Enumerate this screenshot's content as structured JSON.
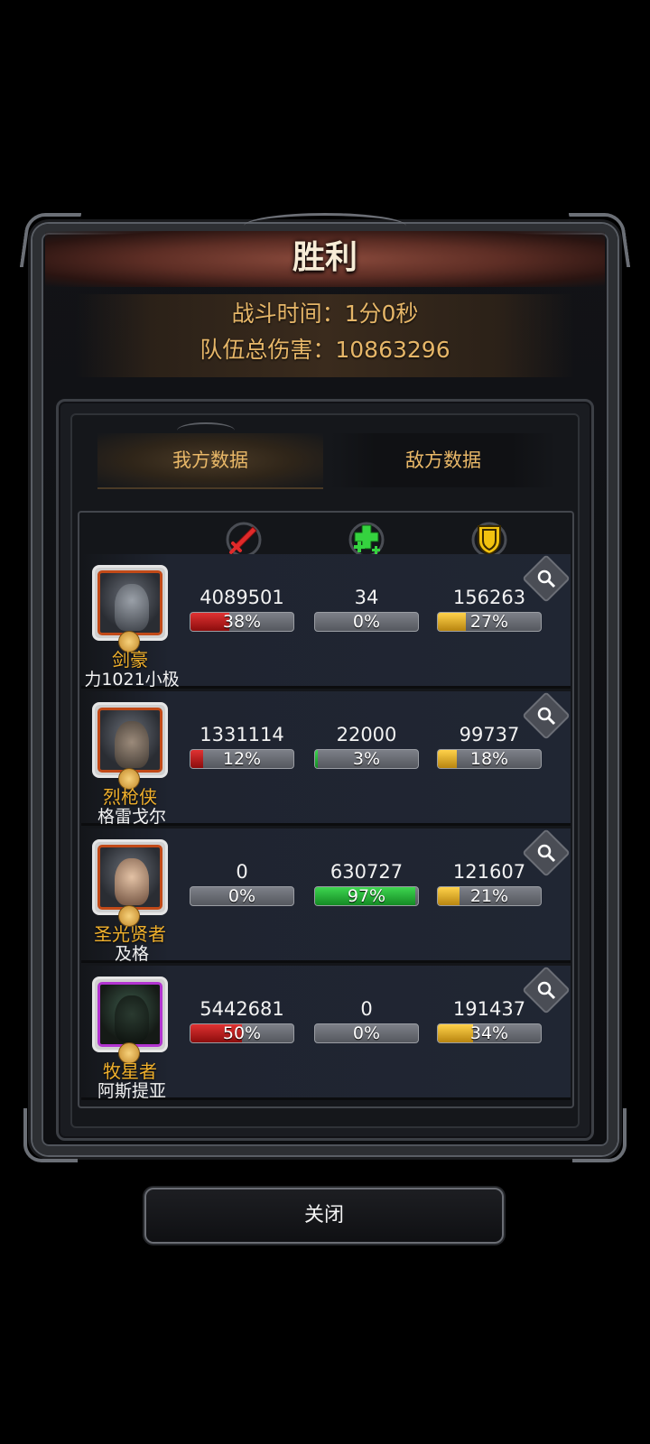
{
  "title": "胜利",
  "battle_time": {
    "label": "战斗时间：",
    "value": "1分0秒"
  },
  "team_damage": {
    "label": "队伍总伤害：",
    "value": "10863296"
  },
  "tabs": [
    {
      "label": "我方数据",
      "active": true
    },
    {
      "label": "敌方数据",
      "active": false
    }
  ],
  "columns": [
    {
      "icon": "sword-icon",
      "color": "#e02a2a"
    },
    {
      "icon": "heal-cross-icon",
      "color": "#35d33f"
    },
    {
      "icon": "shield-icon",
      "color": "#f2c20f"
    }
  ],
  "heroes": [
    {
      "class": "剑豪",
      "name": "力1021小极",
      "frame": "orange",
      "damage": {
        "value": "4089501",
        "pct": "38%",
        "fraction": 0.38
      },
      "heal": {
        "value": "34",
        "pct": "0%",
        "fraction": 0.0
      },
      "tank": {
        "value": "156263",
        "pct": "27%",
        "fraction": 0.27
      }
    },
    {
      "class": "烈枪侠",
      "name": "格雷戈尔",
      "frame": "orange",
      "damage": {
        "value": "1331114",
        "pct": "12%",
        "fraction": 0.12
      },
      "heal": {
        "value": "22000",
        "pct": "3%",
        "fraction": 0.03
      },
      "tank": {
        "value": "99737",
        "pct": "18%",
        "fraction": 0.18
      }
    },
    {
      "class": "圣光贤者",
      "name": "及格",
      "frame": "orange",
      "damage": {
        "value": "0",
        "pct": "0%",
        "fraction": 0.0
      },
      "heal": {
        "value": "630727",
        "pct": "97%",
        "fraction": 0.97
      },
      "tank": {
        "value": "121607",
        "pct": "21%",
        "fraction": 0.21
      }
    },
    {
      "class": "牧星者",
      "name": "阿斯提亚",
      "frame": "purple",
      "damage": {
        "value": "5442681",
        "pct": "50%",
        "fraction": 0.5
      },
      "heal": {
        "value": "0",
        "pct": "0%",
        "fraction": 0.0
      },
      "tank": {
        "value": "191437",
        "pct": "34%",
        "fraction": 0.34
      }
    }
  ],
  "close_label": "关闭"
}
